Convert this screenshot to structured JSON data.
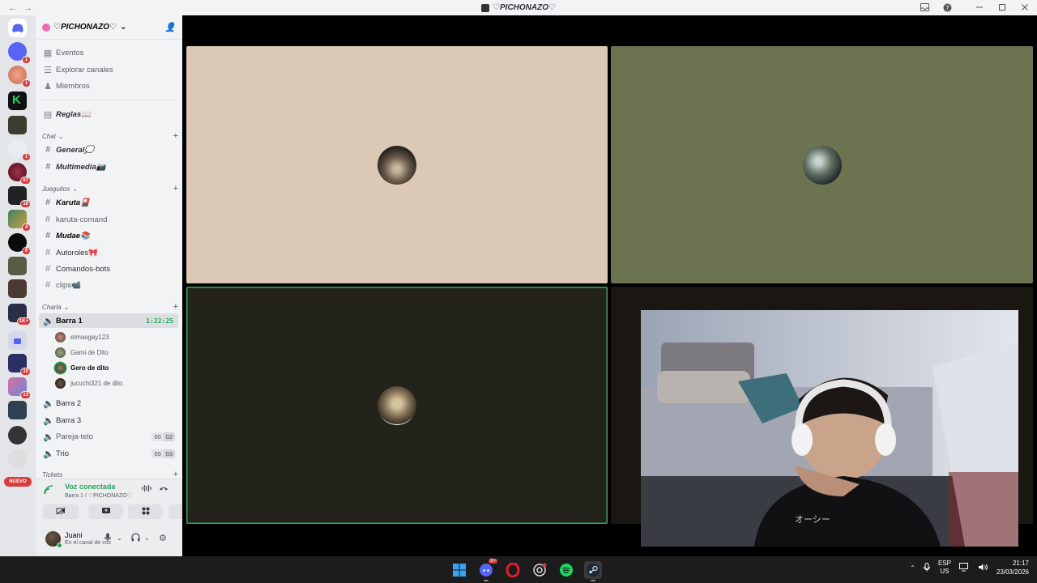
{
  "window": {
    "title": "♡PICHONAZO♡",
    "back": "←",
    "forward": "→",
    "icons": [
      "inbox-icon",
      "help-icon",
      "minimize-icon",
      "maximize-icon",
      "close-icon"
    ]
  },
  "rail": {
    "badges": [
      "1",
      "1",
      "1",
      "67",
      "16",
      "4",
      "6",
      "1K+",
      "10",
      "13"
    ],
    "new_label": "NUEVO"
  },
  "server": {
    "name": "♡PICHONAZO♡",
    "top_items": [
      "Eventos",
      "Explorar canales",
      "Miembros"
    ],
    "rules": "Reglas📖",
    "categories": {
      "chat": "Chat",
      "jueguitos": "Jueguitos",
      "charla": "Charla",
      "tickets": "Tickets"
    },
    "chat_channels": [
      "General💭",
      "Multimedia📷"
    ],
    "game_channels": [
      "Karuta🎴",
      "karuta-comand",
      "Mudae📚",
      "Autoroles🎀",
      "Comandos-bots",
      "clips📹"
    ],
    "voice_channels": [
      {
        "name": "Barra 1",
        "timer": "1:22:25"
      },
      {
        "name": "Barra 2"
      },
      {
        "name": "Barra 3"
      },
      {
        "name": "Pareja-telo",
        "count_a": "00",
        "count_b": "02"
      },
      {
        "name": "Trio",
        "count_a": "00",
        "count_b": "03"
      }
    ],
    "voice_users": [
      "elmasgay123",
      "Gami de Dito",
      "Gero de dito",
      "jucuchi321 de dito"
    ]
  },
  "voice_panel": {
    "status": "Voz conectada",
    "location": "Barra 1 / ♡PICHONAZO♡"
  },
  "user_panel": {
    "name": "Juani",
    "status": "En el canal de voz"
  },
  "colors": {
    "tile1": "#dbc8b5",
    "tile2": "#6b7350",
    "tile3": "#23221b",
    "tile4": "#1a1712",
    "speaking": "#3ba55c",
    "connected": "#23a559"
  },
  "taskbar": {
    "lang": "ESP",
    "region": "US",
    "time": "21:17",
    "date": "23/03/2026",
    "discord_badge": "9+"
  }
}
